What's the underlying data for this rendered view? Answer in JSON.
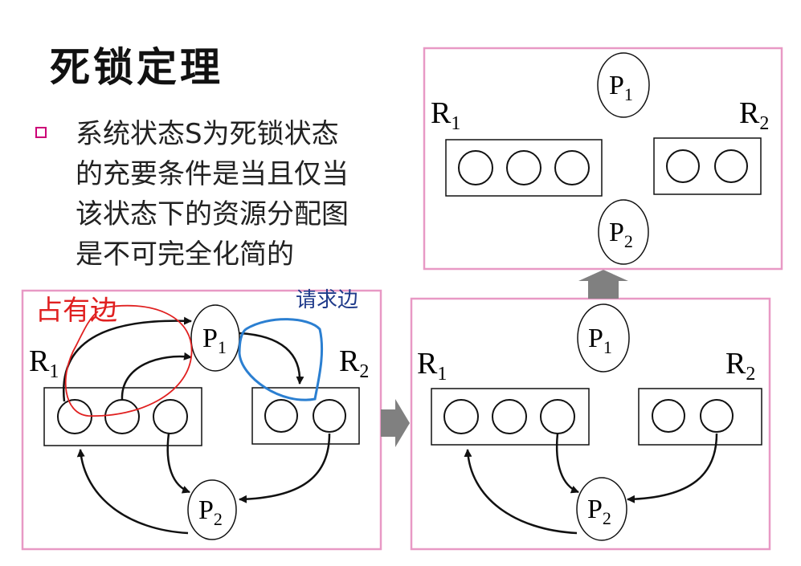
{
  "title": "死锁定理",
  "bullet": {
    "lines": [
      "系统状态S为死锁状态",
      "的充要条件是当且仅当",
      "该状态下的资源分配图",
      "是不可完全化简的"
    ]
  },
  "annotations": {
    "request_edge": "请求边",
    "assignment_edge": "占有边"
  },
  "labels": {
    "p1_base": "P",
    "p1_sub": "1",
    "p2_base": "P",
    "p2_sub": "2",
    "r1_base": "R",
    "r1_sub": "1",
    "r2_base": "R",
    "r2_sub": "2"
  },
  "colors": {
    "frame": "#e899c5",
    "bullet": "#cc0077",
    "annotation_text": "#1f3a8a",
    "red_ink": "#e02020",
    "blue_ink": "#2b7fd1",
    "arrow_fill": "#808080"
  }
}
